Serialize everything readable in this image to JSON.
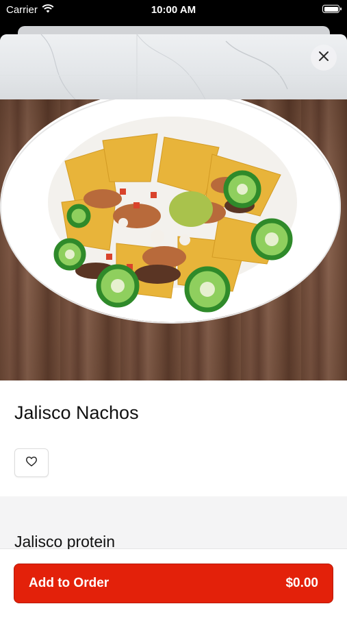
{
  "status_bar": {
    "carrier": "Carrier",
    "time": "10:00 AM",
    "icons": [
      "wifi-icon",
      "battery-icon"
    ]
  },
  "item": {
    "name": "Jalisco Nachos",
    "image": "nachos-photo"
  },
  "actions": {
    "close_icon": "close-icon",
    "favorite_icon": "heart-icon"
  },
  "sections": [
    {
      "title": "Jalisco protein"
    }
  ],
  "footer": {
    "add_label": "Add to Order",
    "price": "$0.00"
  },
  "colors": {
    "accent": "#e3210a",
    "section_bg": "#f4f4f5",
    "text": "#111111"
  }
}
